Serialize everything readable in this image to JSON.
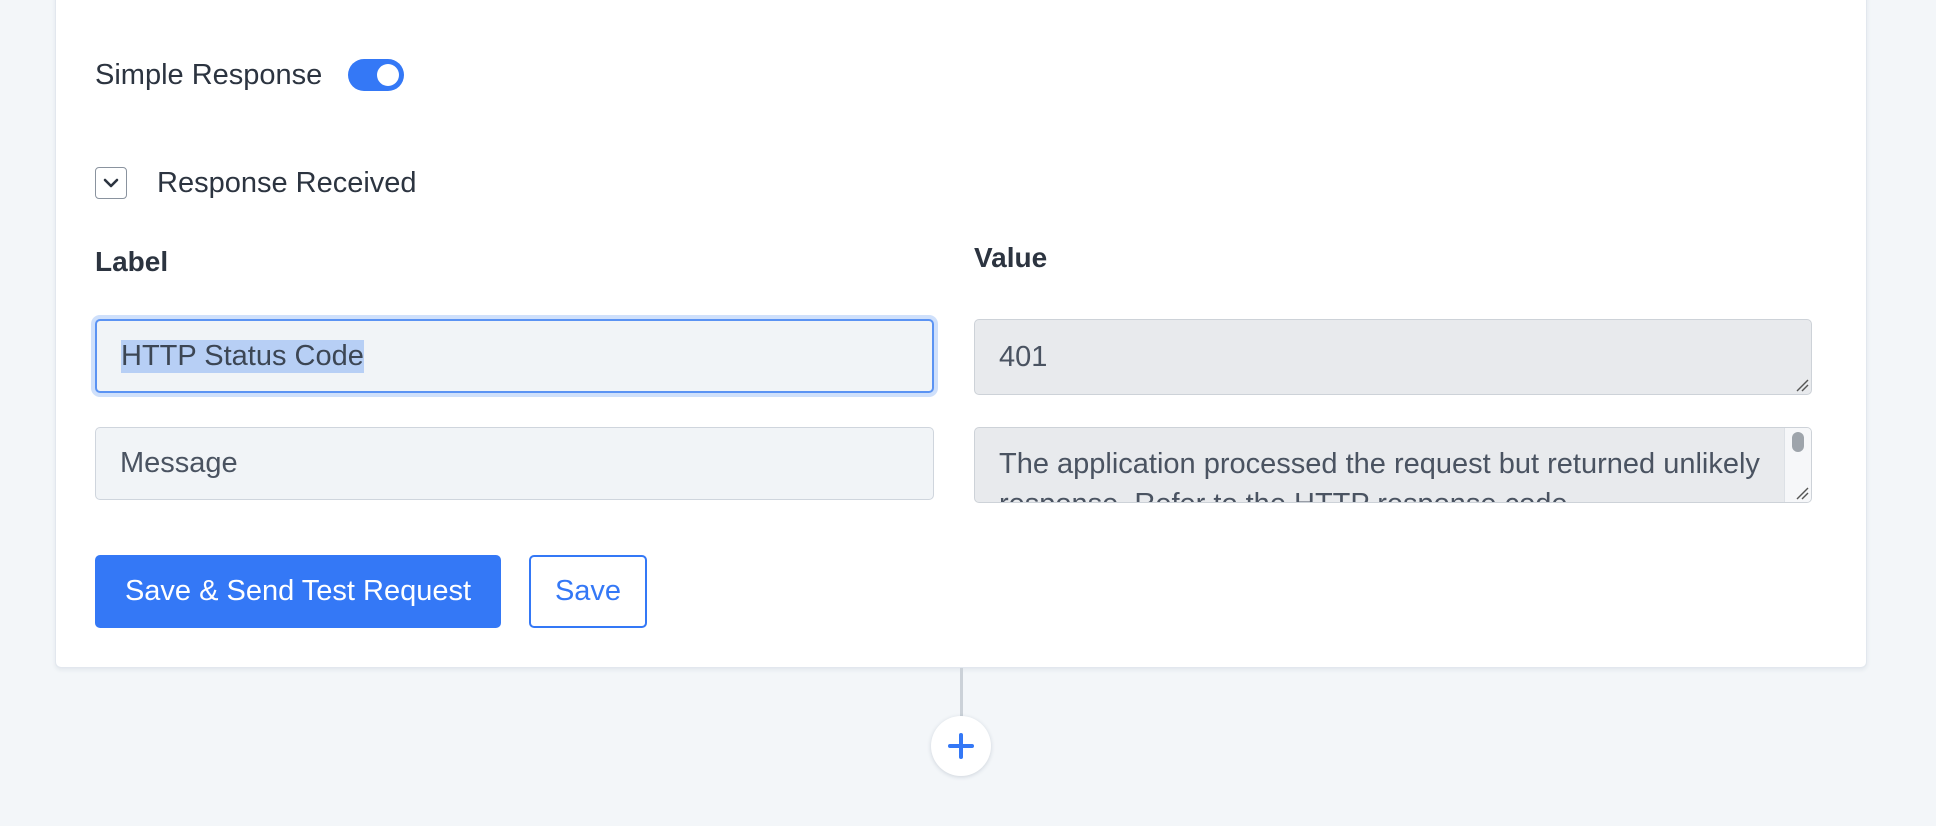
{
  "toggle": {
    "label": "Simple Response",
    "state": "on",
    "color": "#3478f6"
  },
  "section": {
    "title": "Response Received",
    "icon": "chevron-down-icon"
  },
  "columns": {
    "label_header": "Label",
    "value_header": "Value"
  },
  "rows": [
    {
      "label": "HTTP Status Code",
      "value": "401"
    },
    {
      "label": "Message",
      "value": "The application processed the request but returned unlikely response. Refer to the HTTP response code"
    }
  ],
  "actions": {
    "primary_label": "Save & Send Test Request",
    "secondary_label": "Save"
  },
  "add_step": {
    "icon": "plus-icon"
  },
  "colors": {
    "accent": "#3478f6",
    "background": "#f3f6f9"
  }
}
